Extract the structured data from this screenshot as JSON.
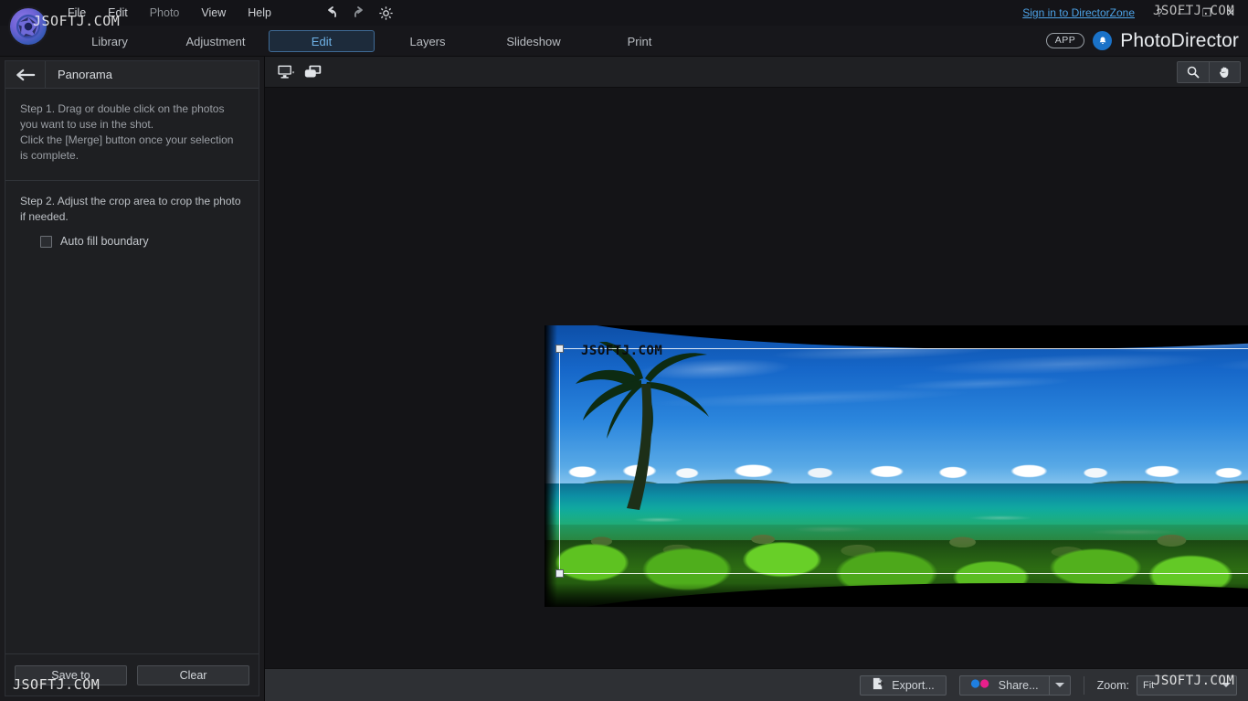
{
  "window": {
    "app_name": "PhotoDirector",
    "app_badge": "APP",
    "signin_link": "Sign in to DirectorZone",
    "help_glyph": "?",
    "minimize_glyph": "—",
    "restore_glyph": "❐",
    "close_glyph": "✕"
  },
  "menu": {
    "items": [
      {
        "label": "File",
        "dim": false
      },
      {
        "label": "Edit",
        "dim": false
      },
      {
        "label": "Photo",
        "dim": true
      },
      {
        "label": "View",
        "dim": false
      },
      {
        "label": "Help",
        "dim": false
      }
    ],
    "history": [
      {
        "name": "undo-icon"
      },
      {
        "name": "redo-icon"
      },
      {
        "name": "settings-gear-icon"
      }
    ]
  },
  "tabs": [
    {
      "label": "Library",
      "active": false
    },
    {
      "label": "Adjustment",
      "active": false
    },
    {
      "label": "Edit",
      "active": true
    },
    {
      "label": "Layers",
      "active": false
    },
    {
      "label": "Slideshow",
      "active": false
    },
    {
      "label": "Print",
      "active": false
    }
  ],
  "panel": {
    "title": "Panorama",
    "back_icon": "back-arrow-icon",
    "step1": "Step 1. Drag or double click on the photos you want to use in the shot.\nClick the [Merge] button once your selection is complete.",
    "step2": "Step 2. Adjust the crop area to crop the photo if needed.",
    "auto_fill_label": "Auto fill boundary",
    "auto_fill_checked": false,
    "save_button": "Save to",
    "clear_button": "Clear"
  },
  "canvas_toolbar": {
    "view_mode_icon": "monitor-view-icon",
    "compare_icon": "compare-view-icon",
    "zoom_tool_icon": "magnifier-icon",
    "hand_tool_icon": "hand-pan-icon"
  },
  "bottom_bar": {
    "export_label": "Export...",
    "export_icon": "export-icon",
    "share_label": "Share...",
    "share_caret_icon": "chevron-down-icon",
    "zoom_label": "Zoom:",
    "zoom_value": "Fit"
  },
  "colors": {
    "accent_blue": "#6fb3e8",
    "tab_active_bg": "#1d2b3b",
    "tab_active_border": "#3f6b96",
    "link_blue": "#4da3e8",
    "panel_bg": "#1e1f22",
    "bottom_bar_bg": "#2e3034"
  },
  "photo": {
    "alt": "Stitched tropical beach panorama with palm trees, turquoise sea and green foliage",
    "crop_handles": [
      "top-left",
      "top-right",
      "bottom-left",
      "bottom-right"
    ]
  },
  "watermark": {
    "text": "JSOFTJ.COM"
  }
}
